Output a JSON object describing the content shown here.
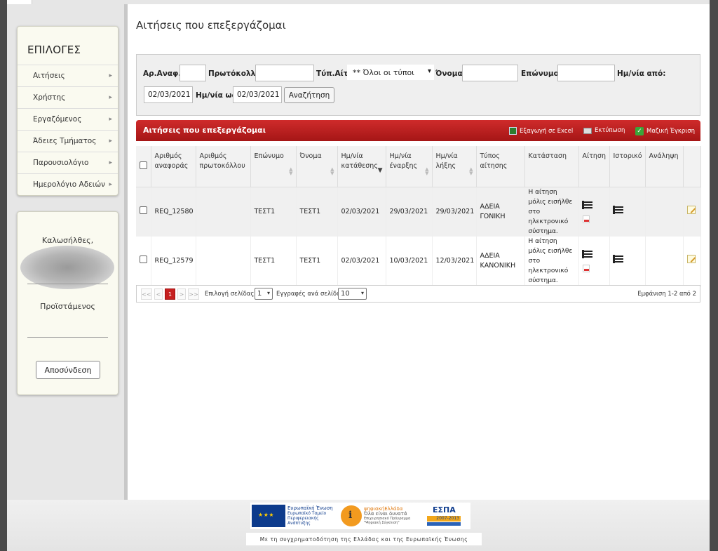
{
  "sidebar": {
    "title": "ΕΠΙΛΟΓΕΣ",
    "items": [
      {
        "label": "Αιτήσεις"
      },
      {
        "label": "Χρήστης"
      },
      {
        "label": "Εργαζόμενος"
      },
      {
        "label": "Άδειες Τμήματος"
      },
      {
        "label": "Παρουσιολόγιο"
      },
      {
        "label": "Ημερολόγιο Αδειών"
      }
    ],
    "welcome": "Καλωσήλθες,",
    "role": "Προϊστάμενος",
    "logout_label": "Αποσύνδεση"
  },
  "main": {
    "title": "Αιτήσεις που επεξεργάζομαι"
  },
  "filters": {
    "ref_label": "Αρ.Αναφ.:",
    "ref_value": "",
    "protocol_label": "Πρωτόκολλο:",
    "protocol_value": "",
    "type_label": "Τύπ.Αίτ.:",
    "type_value": "** Όλοι οι τύποι",
    "name_label": "Όνομα:",
    "name_value": "",
    "surname_label": "Επώνυμο:",
    "surname_value": "",
    "date_from_label": "Ημ/νία από:",
    "date_from_value": "02/03/2021",
    "date_to_label": "Ημ/νία ως:",
    "date_to_value": "02/03/2021",
    "search_label": "Αναζήτηση"
  },
  "grid": {
    "title": "Αιτήσεις που επεξεργάζομαι",
    "actions": {
      "excel": "Εξαγωγή σε Excel",
      "print": "Εκτύπωση",
      "approve": "Μαζική Έγκριση"
    },
    "columns": {
      "ref": [
        "Αριθμός",
        "αναφοράς"
      ],
      "protocol": [
        "Αριθμός",
        "πρωτοκόλλου"
      ],
      "surname": [
        "Επώνυμο"
      ],
      "name": [
        "Όνομα"
      ],
      "submit": [
        "Ημ/νία",
        "κατάθεσης"
      ],
      "start": [
        "Ημ/νία",
        "έναρξης"
      ],
      "end": [
        "Ημ/νία",
        "λήξης"
      ],
      "type": [
        "Τύπος",
        "αίτησης"
      ],
      "status": [
        "Κατάσταση"
      ],
      "request": [
        "Αίτηση"
      ],
      "history": [
        "Ιστορικό"
      ],
      "take": [
        "Ανάληψη"
      ]
    },
    "rows": [
      {
        "ref": "REQ_12580",
        "protocol": "",
        "surname": "ΤΕΣΤ1",
        "name": "ΤΕΣΤ1",
        "submit": "02/03/2021",
        "start": "29/03/2021",
        "end": "29/03/2021",
        "type": "ΑΔΕΙΑ ΓΟΝΙΚΗ",
        "status": "Η αίτηση μόλις εισήλθε στο ηλεκτρονικό σύστημα."
      },
      {
        "ref": "REQ_12579",
        "protocol": "",
        "surname": "ΤΕΣΤ1",
        "name": "ΤΕΣΤ1",
        "submit": "02/03/2021",
        "start": "10/03/2021",
        "end": "12/03/2021",
        "type": "ΑΔΕΙΑ ΚΑΝΟΝΙΚΗ",
        "status": "Η αίτηση μόλις εισήλθε στο ηλεκτρονικό σύστημα."
      }
    ]
  },
  "pager": {
    "first": "<<",
    "prev": "<",
    "current": "1",
    "next": ">",
    "last": ">>",
    "page_select_label": "Επιλογή σελίδας:",
    "page_select_value": "1",
    "per_page_label": "Εγγραφές ανά σελίδα:",
    "per_page_value": "10",
    "summary": "Εμφάνιση 1-2 από 2"
  },
  "footer": {
    "eu_line1": "Ευρωπαϊκή Ένωση",
    "eu_line2": "Ευρωπαϊκό Ταμείο Περιφερειακής Ανάπτυξης",
    "dg_brand": "ψηφιακήΕλλάδα",
    "dg_line": "Όλα είναι δυνατά",
    "dg_line2": "Επιχειρησιακό Πρόγραμμα \"Ψηφιακή Σύγκλιση\"",
    "espa": "ΕΣΠΑ",
    "espa_years": "2007-2013",
    "cofund": "Με τη συγχρηματοδότηση της Ελλάδας και της Ευρωπαϊκής Ένωσης"
  },
  "colors": {
    "accent_red": "#c62020",
    "menu_bg": "#fafaf0"
  }
}
